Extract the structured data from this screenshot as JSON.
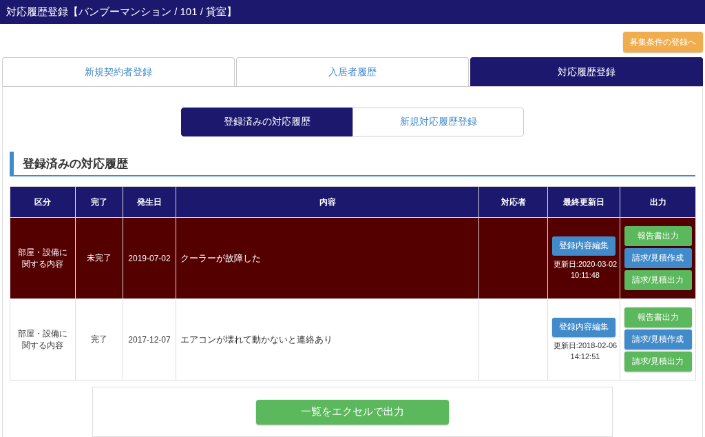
{
  "header": {
    "title": "対応履歴登録【バンブーマンション / 101 / 貸室】"
  },
  "top_button": {
    "label": "募集条件の登録へ"
  },
  "tabs": [
    {
      "label": "新規契約者登録",
      "selected": false
    },
    {
      "label": "入居者履歴",
      "selected": false
    },
    {
      "label": "対応履歴登録",
      "selected": true
    }
  ],
  "sub_tabs": [
    {
      "label": "登録済みの対応履歴",
      "selected": true
    },
    {
      "label": "新規対応履歴登録",
      "selected": false
    }
  ],
  "section_title": "登録済みの対応履歴",
  "table": {
    "columns": [
      "区分",
      "完了",
      "発生日",
      "内容",
      "対応者",
      "最終更新日",
      "出力"
    ],
    "rows": [
      {
        "category": "部屋・設備に関する内容",
        "status": "未完了",
        "date": "2019-07-02",
        "content": "クーラーが故障した",
        "edit_button": "登録内容編集",
        "updated": "更新日:2020-03-02 10:11:48",
        "highlighted": true,
        "actions": [
          {
            "label": "報告書出力",
            "kind": "output"
          },
          {
            "label": "請求/見積作成",
            "kind": "create"
          },
          {
            "label": "請求/見積出力",
            "kind": "output"
          }
        ]
      },
      {
        "category": "部屋・設備に関する内容",
        "status": "完了",
        "date": "2017-12-07",
        "content": "エアコンが壊れて動かないと連絡あり",
        "edit_button": "登録内容編集",
        "updated": "更新日:2018-02-06 14:12:51",
        "highlighted": false,
        "actions": [
          {
            "label": "報告書出力",
            "kind": "output"
          },
          {
            "label": "請求/見積作成",
            "kind": "create"
          },
          {
            "label": "請求/見積出力",
            "kind": "output"
          }
        ]
      }
    ]
  },
  "export_button": "一覧をエクセルで出力"
}
